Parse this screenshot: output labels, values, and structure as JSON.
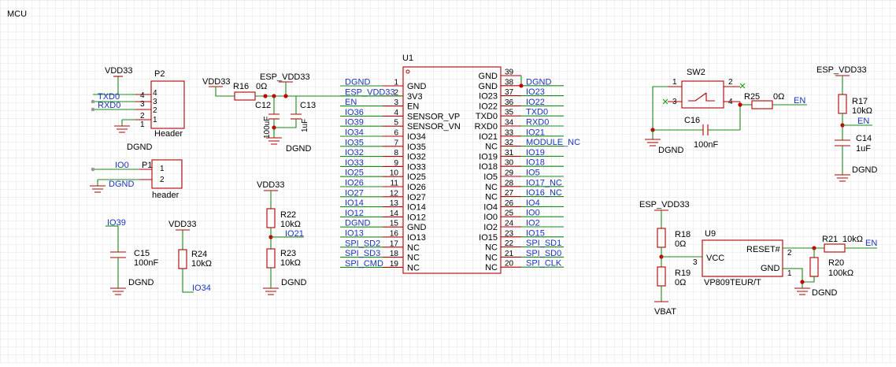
{
  "sheet": {
    "title": "MCU",
    "grid_visible": true,
    "colors": {
      "background": "#ffffff",
      "grid": "#e6e6e6",
      "wire": "#1a8a1a",
      "part": "#b00000",
      "net_label": "#1a33c0",
      "junction": "#c80000"
    }
  },
  "u1": {
    "ref": "U1",
    "left_pins": [
      {
        "num": "1",
        "name": "GND",
        "net": "DGND"
      },
      {
        "num": "2",
        "name": "3V3",
        "net": "ESP_VDD33"
      },
      {
        "num": "3",
        "name": "EN",
        "net": "EN"
      },
      {
        "num": "4",
        "name": "SENSOR_VP",
        "net": "IO36"
      },
      {
        "num": "5",
        "name": "SENSOR_VN",
        "net": "IO39"
      },
      {
        "num": "6",
        "name": "IO34",
        "net": "IO34"
      },
      {
        "num": "7",
        "name": "IO35",
        "net": "IO35"
      },
      {
        "num": "8",
        "name": "IO32",
        "net": "IO32"
      },
      {
        "num": "9",
        "name": "IO33",
        "net": "IO33"
      },
      {
        "num": "10",
        "name": "IO25",
        "net": "IO25"
      },
      {
        "num": "11",
        "name": "IO26",
        "net": "IO26"
      },
      {
        "num": "12",
        "name": "IO27",
        "net": "IO27"
      },
      {
        "num": "13",
        "name": "IO14",
        "net": "IO14"
      },
      {
        "num": "14",
        "name": "IO12",
        "net": "IO12"
      },
      {
        "num": "15",
        "name": "GND",
        "net": "DGND"
      },
      {
        "num": "16",
        "name": "IO13",
        "net": "IO13"
      },
      {
        "num": "17",
        "name": "NC",
        "net": "SPI_SD2"
      },
      {
        "num": "18",
        "name": "NC",
        "net": "SPI_SD3"
      },
      {
        "num": "19",
        "name": "NC",
        "net": "SPI_CMD"
      }
    ],
    "right_pins": [
      {
        "num": "39",
        "name": "GND",
        "net": ""
      },
      {
        "num": "38",
        "name": "GND",
        "net": "DGND"
      },
      {
        "num": "37",
        "name": "IO23",
        "net": "IO23"
      },
      {
        "num": "36",
        "name": "IO22",
        "net": "IO22"
      },
      {
        "num": "35",
        "name": "TXD0",
        "net": "TXD0"
      },
      {
        "num": "34",
        "name": "RXD0",
        "net": "RXD0"
      },
      {
        "num": "33",
        "name": "IO21",
        "net": "IO21"
      },
      {
        "num": "32",
        "name": "NC",
        "net": "MODULE_NC"
      },
      {
        "num": "31",
        "name": "IO19",
        "net": "IO19"
      },
      {
        "num": "30",
        "name": "IO18",
        "net": "IO18"
      },
      {
        "num": "29",
        "name": "IO5",
        "net": "IO5"
      },
      {
        "num": "28",
        "name": "NC",
        "net": "IO17_NC"
      },
      {
        "num": "27",
        "name": "NC",
        "net": "IO16_NC"
      },
      {
        "num": "26",
        "name": "IO4",
        "net": "IO4"
      },
      {
        "num": "25",
        "name": "IO0",
        "net": "IO0"
      },
      {
        "num": "24",
        "name": "IO2",
        "net": "IO2"
      },
      {
        "num": "23",
        "name": "IO15",
        "net": "IO15"
      },
      {
        "num": "22",
        "name": "NC",
        "net": "SPI_SD1"
      },
      {
        "num": "21",
        "name": "NC",
        "net": "SPI_SD0"
      },
      {
        "num": "20",
        "name": "NC",
        "net": "SPI_CLK"
      }
    ]
  },
  "p2": {
    "ref": "P2",
    "value": "Header",
    "pins": [
      "4",
      "3",
      "2",
      "1"
    ],
    "nets": {
      "pin4": "TXD0",
      "pin3": "RXD0",
      "power": "VDD33",
      "gnd": "DGND"
    }
  },
  "p1": {
    "ref": "P1",
    "value": "header",
    "pins": [
      "1",
      "2"
    ],
    "nets": {
      "pin1": "IO0",
      "pin2": "DGND"
    }
  },
  "power_in": {
    "vdd": "VDD33",
    "esp": "ESP_VDD33",
    "gnd": "DGND",
    "r16": {
      "ref": "R16",
      "value": "0Ω"
    },
    "c12": {
      "ref": "C12",
      "value": "100uF"
    },
    "c13": {
      "ref": "C13",
      "value": "1uF"
    }
  },
  "c15": {
    "net": "IO39",
    "ref": "C15",
    "value": "100nF",
    "gnd": "DGND"
  },
  "r24": {
    "vdd": "VDD33",
    "ref": "R24",
    "value": "10kΩ",
    "net": "IO34"
  },
  "r22_r23": {
    "vdd": "VDD33",
    "net": "IO21",
    "gnd": "DGND",
    "r22": {
      "ref": "R22",
      "value": "10kΩ"
    },
    "r23": {
      "ref": "R23",
      "value": "10kΩ"
    }
  },
  "en_circuit": {
    "sw2": {
      "ref": "SW2",
      "pins": [
        "1",
        "2",
        "3",
        "4"
      ]
    },
    "c16": {
      "ref": "C16",
      "value": "100nF"
    },
    "r25": {
      "ref": "R25",
      "value": "0Ω"
    },
    "en": "EN",
    "gnd": "DGND"
  },
  "en_rc": {
    "esp": "ESP_VDD33",
    "en": "EN",
    "gnd": "DGND",
    "r17": {
      "ref": "R17",
      "value": "10kΩ"
    },
    "c14": {
      "ref": "C14",
      "value": "1uF"
    }
  },
  "reset": {
    "esp": "ESP_VDD33",
    "vbat": "VBAT",
    "gnd": "DGND",
    "en": "EN",
    "u9": {
      "ref": "U9",
      "value": "VP809TEUR/T",
      "vcc": "VCC",
      "reset": "RESET#",
      "gnd_pin": "GND",
      "pin_vcc": "3",
      "pin_reset": "2",
      "pin_gnd": "1"
    },
    "r18": {
      "ref": "R18",
      "value": "0Ω"
    },
    "r19": {
      "ref": "R19",
      "value": "0Ω"
    },
    "r20": {
      "ref": "R20",
      "value": "100kΩ"
    },
    "r21": {
      "ref": "R21",
      "value": "10kΩ"
    }
  }
}
